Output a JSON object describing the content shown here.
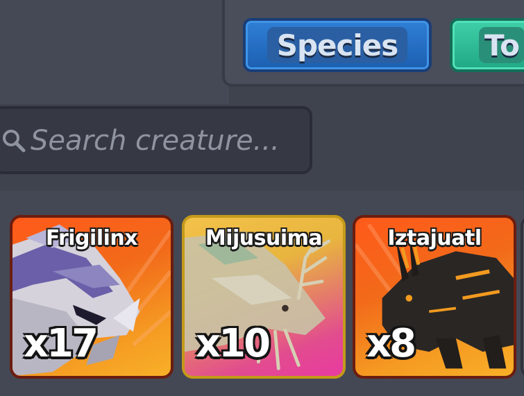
{
  "tabs": [
    {
      "label": "Species",
      "color": "#2f7fd6"
    },
    {
      "label": "To",
      "color": "#3fd0a8"
    }
  ],
  "search": {
    "placeholder": "Search creature..."
  },
  "creatures": [
    {
      "name": "Frigilinx",
      "count": "x17",
      "rarity_color": "#f26a1a",
      "icon": "frigilinx-portrait-icon"
    },
    {
      "name": "Mijusuima",
      "count": "x10",
      "rarity_color": "#e8b53e",
      "icon": "mijusuima-portrait-icon"
    },
    {
      "name": "Iztajuatl",
      "count": "x8",
      "rarity_color": "#f26a1a",
      "icon": "iztajuatl-portrait-icon"
    }
  ]
}
